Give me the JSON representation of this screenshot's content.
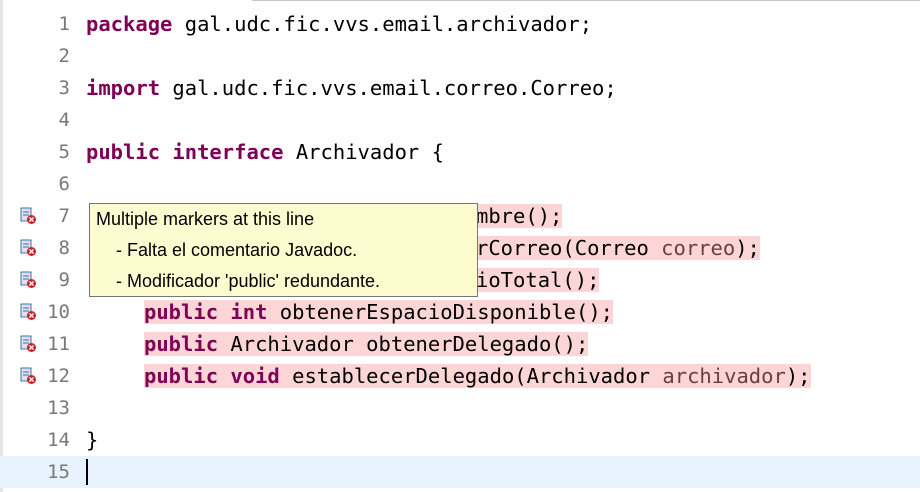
{
  "tooltip": {
    "title": "Multiple markers at this line",
    "items": [
      "- Falta el comentario Javadoc.",
      "- Modificador 'public' redundante."
    ]
  },
  "lines": [
    {
      "num": "1"
    },
    {
      "num": "2"
    },
    {
      "num": "3"
    },
    {
      "num": "4"
    },
    {
      "num": "5"
    },
    {
      "num": "6"
    },
    {
      "num": "7"
    },
    {
      "num": "8"
    },
    {
      "num": "9"
    },
    {
      "num": "10"
    },
    {
      "num": "11"
    },
    {
      "num": "12"
    },
    {
      "num": "13"
    },
    {
      "num": "14"
    },
    {
      "num": "15"
    }
  ],
  "code": {
    "l1": {
      "kw": "package",
      "rest": " gal.udc.fic.vvs.email.archivador;"
    },
    "l3": {
      "kw": "import",
      "rest": " gal.udc.fic.vvs.email.correo.Correo;"
    },
    "l5": {
      "kw1": "public",
      "kw2": "interface",
      "rest": " Archivador {"
    },
    "l7": {
      "rest": "mbre();"
    },
    "l8": {
      "rest": "rCorreo(Correo ",
      "var": "correo",
      "end": ");"
    },
    "l9": {
      "rest": "ioTotal();"
    },
    "l10": {
      "kw1": "public",
      "kw2": "int",
      "rest": " obtenerEspacioDisponible();"
    },
    "l11": {
      "kw1": "public",
      "rest": " Archivador obtenerDelegado();"
    },
    "l12": {
      "kw1": "public",
      "kw2": "void",
      "rest": " establecerDelegado(Archivador ",
      "var": "archivador",
      "end": ");"
    },
    "l14": {
      "rest": "}"
    }
  },
  "colors": {
    "keyword": "#7f0055",
    "error_highlight": "#fcd6d6",
    "current_line": "#e8f2fe",
    "tooltip_bg": "#fdfbd0",
    "line_number": "#787878"
  }
}
